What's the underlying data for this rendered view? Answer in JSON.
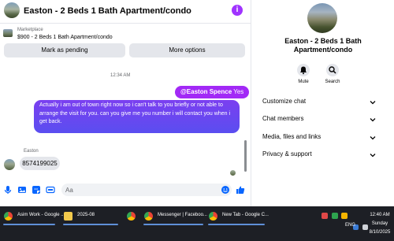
{
  "chat": {
    "header_title": "Easton - 2 Beds 1 Bath Apartment/condo",
    "info_icon": "i",
    "listing_kicker": "Marketplace",
    "listing_title": "$900 - 2 Beds 1 Bath Apartment/condo",
    "mark_pending_label": "Mark as pending",
    "more_options_label": "More options",
    "timestamp": "12:34 AM",
    "bubble_mention_name": "@Easton Spence",
    "bubble_mention_rest": "Yes",
    "bubble_long": "Actually i am out of town right now so i can't talk to you briefly or not able to arrange the visit for you. can you give me you number i will contact you when i get back.",
    "sender_name": "Easton",
    "phone_message": "8574199025",
    "composer_placeholder": "Aa",
    "composer_icons": [
      "microphone-icon",
      "photo-icon",
      "sticker-icon",
      "gif-icon",
      "emoji-icon",
      "like-icon"
    ],
    "accent_color": "#a229f6"
  },
  "info": {
    "title": "Easton - 2 Beds 1 Bath Apartment/condo",
    "mute_label": "Mute",
    "search_label": "Search",
    "accordion": [
      {
        "label": "Customize chat"
      },
      {
        "label": "Chat members"
      },
      {
        "label": "Media, files and links"
      },
      {
        "label": "Privacy & support"
      }
    ]
  },
  "taskbar": {
    "items": [
      {
        "label": "Asim Work - Google ...",
        "icon": "chrome-icon"
      },
      {
        "label": "2025-08",
        "icon": "folder-icon"
      },
      {
        "label": "",
        "icon": "chrome-icon"
      },
      {
        "label": "Messenger | Faceboo...",
        "icon": "chrome-icon"
      },
      {
        "label": "New Tab - Google C...",
        "icon": "chrome-icon"
      }
    ],
    "lang": "ENG",
    "time": "12:40 AM",
    "day": "Sunday",
    "date": "8/10/2025"
  }
}
